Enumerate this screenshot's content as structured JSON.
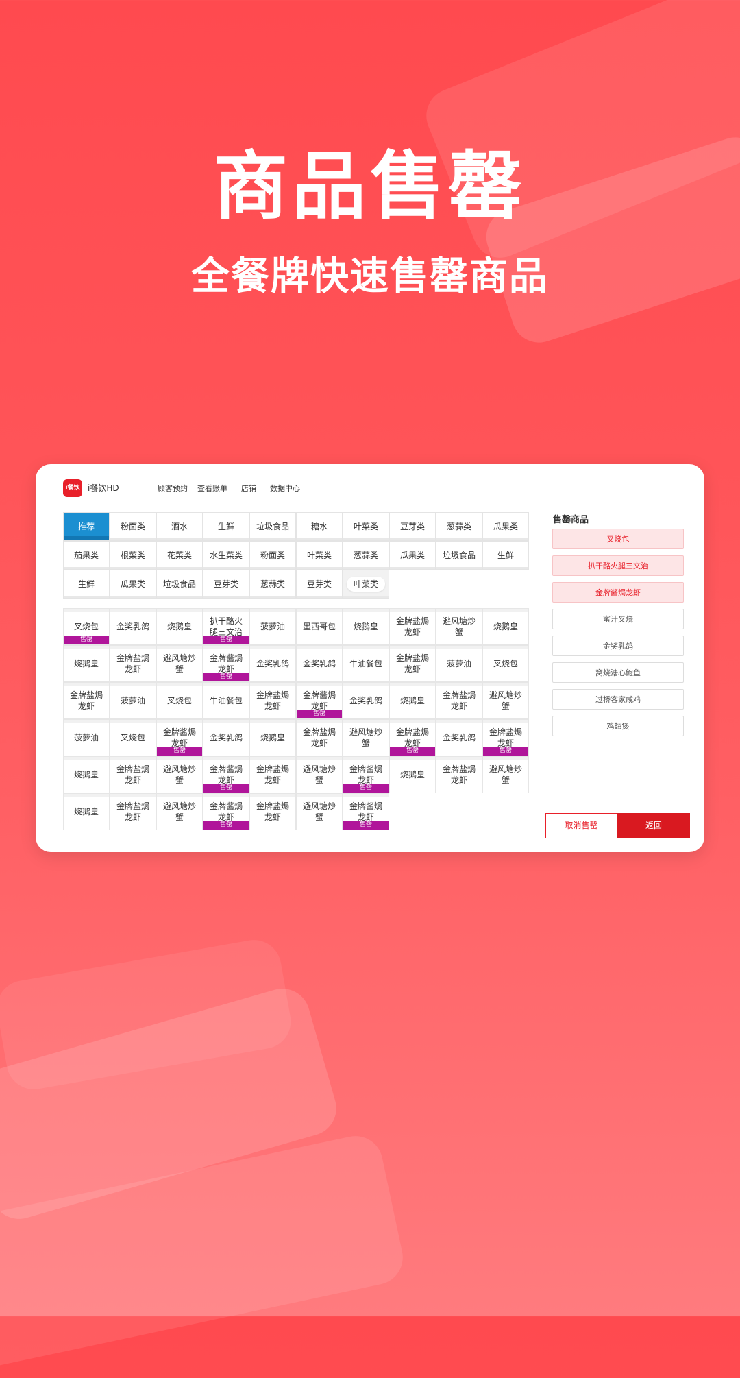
{
  "hero": {
    "title": "商品售罄",
    "subtitle": "全餐牌快速售罄商品"
  },
  "app": {
    "logo_text": "i餐饮",
    "name": "i餐饮HD",
    "nav": [
      "顾客预约",
      "查看账单",
      "店铺",
      "数据中心"
    ]
  },
  "categories": [
    "推荐",
    "粉面类",
    "酒水",
    "生鲜",
    "垃圾食品",
    "糖水",
    "叶菜类",
    "豆芽类",
    "葱蒜类",
    "瓜果类",
    "茄果类",
    "根菜类",
    "花菜类",
    "水生菜类",
    "粉面类",
    "叶菜类",
    "葱蒜类",
    "瓜果类",
    "垃圾食品",
    "生鲜",
    "生鲜",
    "瓜果类",
    "垃圾食品",
    "豆芽类",
    "葱蒜类",
    "豆芽类",
    "叶菜类"
  ],
  "products": [
    {
      "name": "叉烧包",
      "sold": true
    },
    {
      "name": "金奖乳鸽",
      "sold": false
    },
    {
      "name": "烧鹅皇",
      "sold": false
    },
    {
      "name": "扒干酪火腿三文治",
      "sold": true
    },
    {
      "name": "菠萝油",
      "sold": false
    },
    {
      "name": "墨西哥包",
      "sold": false
    },
    {
      "name": "烧鹅皇",
      "sold": false
    },
    {
      "name": "金牌盐焗龙虾",
      "sold": false
    },
    {
      "name": "避风塘炒蟹",
      "sold": false
    },
    {
      "name": "烧鹅皇",
      "sold": false
    },
    {
      "name": "烧鹅皇",
      "sold": false
    },
    {
      "name": "金牌盐焗龙虾",
      "sold": false
    },
    {
      "name": "避风塘炒蟹",
      "sold": false
    },
    {
      "name": "金牌酱焗龙虾",
      "sold": true
    },
    {
      "name": "金奖乳鸽",
      "sold": false
    },
    {
      "name": "金奖乳鸽",
      "sold": false
    },
    {
      "name": "牛油餐包",
      "sold": false
    },
    {
      "name": "金牌盐焗龙虾",
      "sold": false
    },
    {
      "name": "菠萝油",
      "sold": false
    },
    {
      "name": "叉烧包",
      "sold": false
    },
    {
      "name": "金牌盐焗龙虾",
      "sold": false
    },
    {
      "name": "菠萝油",
      "sold": false
    },
    {
      "name": "叉烧包",
      "sold": false
    },
    {
      "name": "牛油餐包",
      "sold": false
    },
    {
      "name": "金牌盐焗龙虾",
      "sold": false
    },
    {
      "name": "金牌酱焗龙虾",
      "sold": true
    },
    {
      "name": "金奖乳鸽",
      "sold": false
    },
    {
      "name": "烧鹅皇",
      "sold": false
    },
    {
      "name": "金牌盐焗龙虾",
      "sold": false
    },
    {
      "name": "避风塘炒蟹",
      "sold": false
    },
    {
      "name": "菠萝油",
      "sold": false
    },
    {
      "name": "叉烧包",
      "sold": false
    },
    {
      "name": "金牌酱焗龙虾",
      "sold": true
    },
    {
      "name": "金奖乳鸽",
      "sold": false
    },
    {
      "name": "烧鹅皇",
      "sold": false
    },
    {
      "name": "金牌盐焗龙虾",
      "sold": false
    },
    {
      "name": "避风塘炒蟹",
      "sold": false
    },
    {
      "name": "金牌盐焗龙虾",
      "sold": true
    },
    {
      "name": "金奖乳鸽",
      "sold": false
    },
    {
      "name": "金牌盐焗龙虾",
      "sold": true
    },
    {
      "name": "烧鹅皇",
      "sold": false
    },
    {
      "name": "金牌盐焗龙虾",
      "sold": false
    },
    {
      "name": "避风塘炒蟹",
      "sold": false
    },
    {
      "name": "金牌酱焗龙虾",
      "sold": true
    },
    {
      "name": "金牌盐焗龙虾",
      "sold": false
    },
    {
      "name": "避风塘炒蟹",
      "sold": false
    },
    {
      "name": "金牌酱焗龙虾",
      "sold": true
    },
    {
      "name": "烧鹅皇",
      "sold": false
    },
    {
      "name": "金牌盐焗龙虾",
      "sold": false
    },
    {
      "name": "避风塘炒蟹",
      "sold": false
    },
    {
      "name": "烧鹅皇",
      "sold": false
    },
    {
      "name": "金牌盐焗龙虾",
      "sold": false
    },
    {
      "name": "避风塘炒蟹",
      "sold": false
    },
    {
      "name": "金牌酱焗龙虾",
      "sold": true
    },
    {
      "name": "金牌盐焗龙虾",
      "sold": false
    },
    {
      "name": "避风塘炒蟹",
      "sold": false
    },
    {
      "name": "金牌酱焗龙虾",
      "sold": true
    }
  ],
  "sold_badge": "售罄",
  "sold_panel": {
    "title": "售罄商品",
    "items": [
      {
        "label": "叉烧包",
        "highlight": true
      },
      {
        "label": "扒干酪火腿三文治",
        "highlight": true
      },
      {
        "label": "金牌酱焗龙虾",
        "highlight": true
      },
      {
        "label": "蜜汁叉烧",
        "highlight": false
      },
      {
        "label": "金奖乳鸽",
        "highlight": false
      },
      {
        "label": "窝烧溏心鲍鱼",
        "highlight": false
      },
      {
        "label": "过桥客家咸鸡",
        "highlight": false
      },
      {
        "label": "鸡翅煲",
        "highlight": false
      }
    ]
  },
  "actions": {
    "cancel": "取消售罄",
    "back": "返回"
  },
  "colors": {
    "brand_red": "#e8202a",
    "active_tab_blue": "#1b8fd1",
    "sold_badge_purple": "#b0159a"
  }
}
